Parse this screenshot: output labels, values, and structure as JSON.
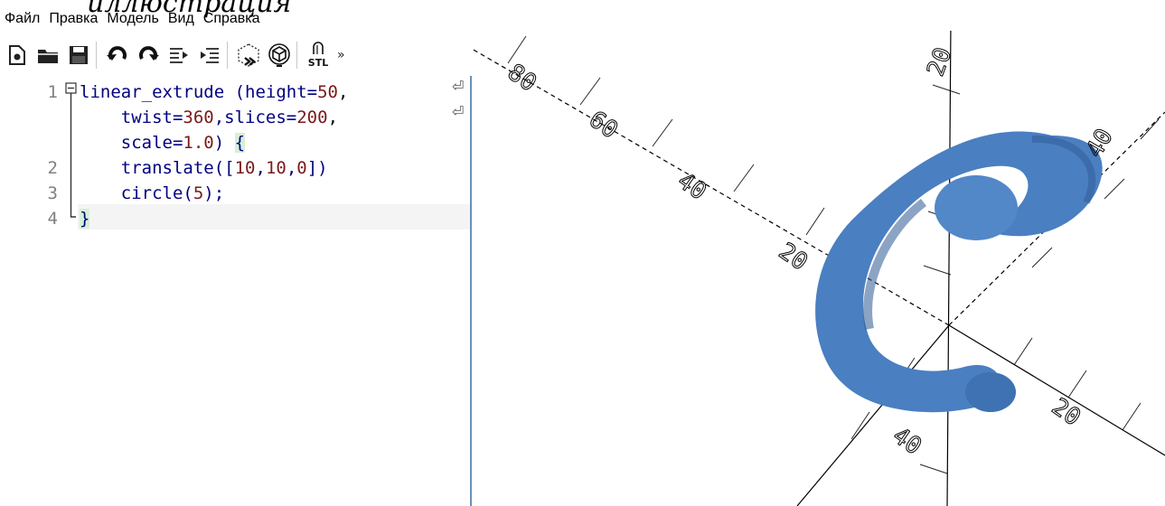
{
  "partial_heading": "иллюстрация",
  "menu": [
    "Файл",
    "Правка",
    "Модель",
    "Вид",
    "Справка"
  ],
  "toolbar": {
    "buttons": [
      {
        "name": "new-file-icon"
      },
      {
        "name": "open-file-icon"
      },
      {
        "name": "save-icon"
      },
      {
        "name": "undo-icon"
      },
      {
        "name": "redo-icon"
      },
      {
        "name": "unindent-icon"
      },
      {
        "name": "indent-icon"
      },
      {
        "name": "preview-icon"
      },
      {
        "name": "render-icon"
      },
      {
        "name": "export-stl-icon"
      }
    ],
    "stl_label": "STL",
    "more": "»"
  },
  "editor": {
    "line_numbers": [
      "1",
      "",
      "",
      "2",
      "3",
      "4"
    ],
    "lines": [
      [
        {
          "t": "linear_extrude (height=",
          "c": "k"
        },
        {
          "t": "50",
          "c": "n"
        },
        {
          "t": ",",
          "c": "p"
        }
      ],
      [
        {
          "t": "    twist=",
          "c": "k"
        },
        {
          "t": "360",
          "c": "n"
        },
        {
          "t": ",slices=",
          "c": "k"
        },
        {
          "t": "200",
          "c": "n"
        },
        {
          "t": ",",
          "c": "p"
        }
      ],
      [
        {
          "t": "    scale=",
          "c": "k"
        },
        {
          "t": "1.0",
          "c": "n"
        },
        {
          "t": ") ",
          "c": "k"
        },
        {
          "t": "{",
          "c": "k"
        }
      ],
      [
        {
          "t": "    translate([",
          "c": "k"
        },
        {
          "t": "10",
          "c": "n"
        },
        {
          "t": ",",
          "c": "k"
        },
        {
          "t": "10",
          "c": "n"
        },
        {
          "t": ",",
          "c": "k"
        },
        {
          "t": "0",
          "c": "n"
        },
        {
          "t": "])",
          "c": "k"
        }
      ],
      [
        {
          "t": "    circle(",
          "c": "k"
        },
        {
          "t": "5",
          "c": "n"
        },
        {
          "t": ");",
          "c": "k"
        }
      ],
      [
        {
          "t": "}",
          "c": "k"
        }
      ]
    ],
    "wrap_marker": "⏎"
  },
  "viewport": {
    "model_color": "#4a7fc1",
    "axis_label_color": "#000000",
    "axis_labels": [
      "80",
      "60",
      "40",
      "20",
      "20",
      "40",
      "20",
      "40"
    ]
  }
}
